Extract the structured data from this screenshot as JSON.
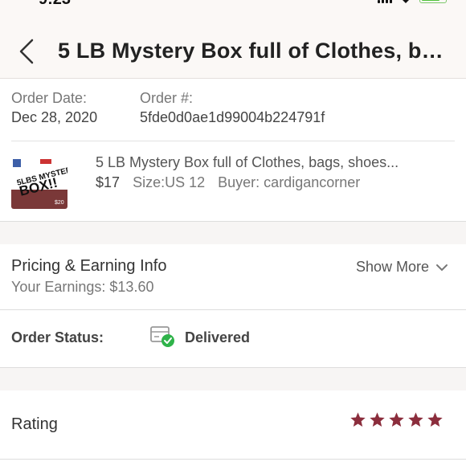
{
  "status_bar": {
    "time": "9:23"
  },
  "header": {
    "title": "5 LB Mystery Box full of Clothes, ba..."
  },
  "order": {
    "date_label": "Order Date:",
    "date_value": "Dec 28, 2020",
    "number_label": "Order #:",
    "number_value": "5fde0d0ae1d99004b224791f"
  },
  "item": {
    "title": "5 LB Mystery Box full of Clothes, bags, shoes...",
    "price": "$17",
    "size": "Size:US 12",
    "buyer": "Buyer: cardigancorner",
    "thumb_text_1": "5LBS MYSTERY",
    "thumb_text_2": "BOX!!",
    "thumb_price": "$20"
  },
  "pricing": {
    "title": "Pricing & Earning Info",
    "earnings": "Your Earnings: $13.60",
    "show_more": "Show More"
  },
  "order_status": {
    "label": "Order Status:",
    "value": "Delivered"
  },
  "rating": {
    "label": "Rating",
    "stars": 5,
    "max": 5
  },
  "colors": {
    "accent": "#8b2d3c",
    "delivered_check": "#2fb34a",
    "header_bg": "#fbf8f6"
  }
}
